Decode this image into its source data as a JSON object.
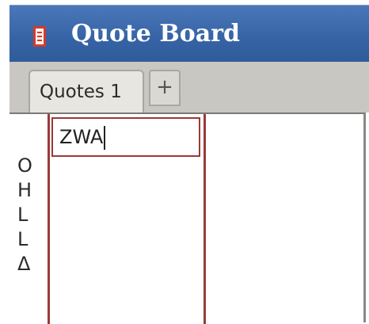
{
  "app": {
    "title": "Quote Board",
    "icon": "notepad-icon"
  },
  "tabs": [
    {
      "label": "Quotes 1",
      "active": true
    }
  ],
  "add_tab_label": "+",
  "side_letters": [
    "O",
    "H",
    "L",
    "L",
    "Δ"
  ],
  "quote_input": {
    "value": "ZWA"
  },
  "colors": {
    "titlebar": "#3663a5",
    "column_border": "#9a3a3a",
    "tabstrip": "#c9c7c1",
    "icon_accent": "#d23c2c"
  }
}
